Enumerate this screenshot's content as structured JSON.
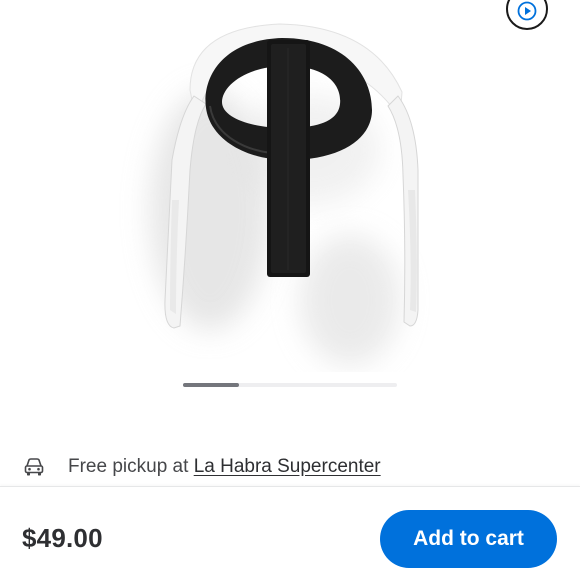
{
  "gallery": {
    "image_alt": "Head strap accessory",
    "video_icon": "play-circle-icon",
    "carousel": {
      "current_index": 1,
      "visible_fraction": 0.26
    }
  },
  "pickup": {
    "icon": "car-icon",
    "prefix": "Free pickup at",
    "store": "La Habra Supercenter"
  },
  "purchase": {
    "price": "$49.00",
    "add_to_cart_label": "Add to cart"
  },
  "colors": {
    "primary_blue": "#0071dc",
    "text_dark": "#2e2f32",
    "text_muted": "#46474a"
  }
}
